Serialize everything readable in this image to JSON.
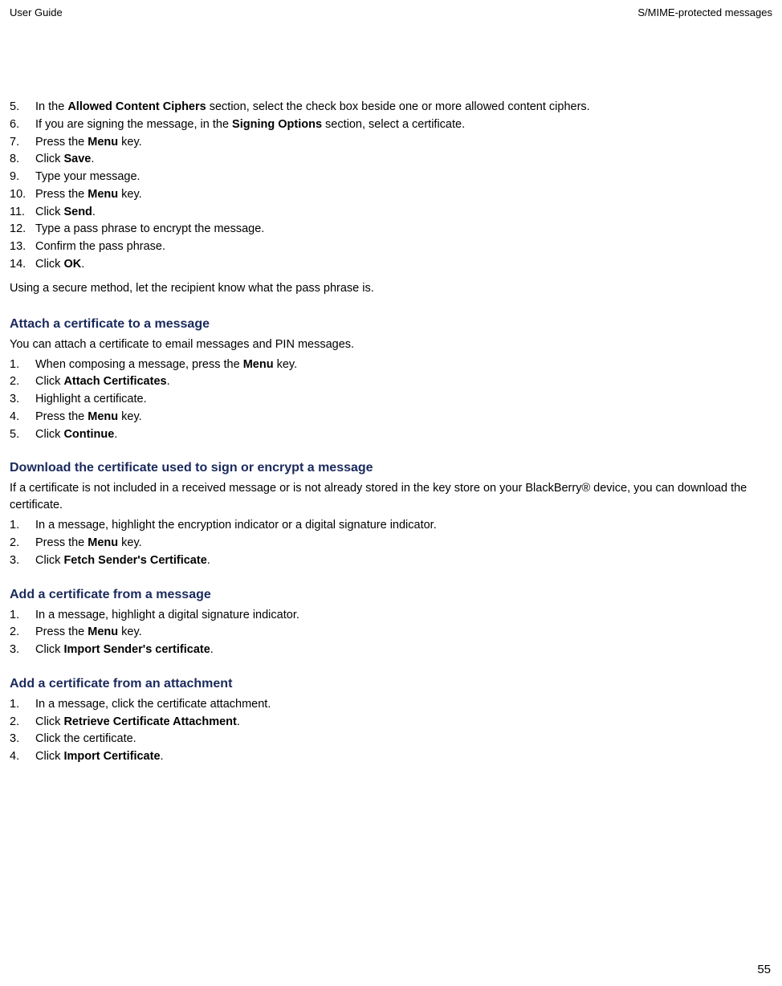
{
  "header": {
    "left": "User Guide",
    "right": "S/MIME-protected messages"
  },
  "firstList": {
    "items": [
      {
        "num": "5.",
        "pre": "In the ",
        "bold1": "Allowed Content Ciphers",
        "post": " section, select the check box beside one or more allowed content ciphers."
      },
      {
        "num": "6.",
        "pre": "If you are signing the message, in the ",
        "bold1": "Signing Options",
        "post": " section, select a certificate."
      },
      {
        "num": "7.",
        "pre": "Press the ",
        "bold1": "Menu",
        "post": " key."
      },
      {
        "num": "8.",
        "pre": "Click ",
        "bold1": "Save",
        "post": "."
      },
      {
        "num": "9.",
        "pre": "Type your message.",
        "bold1": "",
        "post": ""
      },
      {
        "num": "10.",
        "pre": "Press the ",
        "bold1": "Menu",
        "post": " key."
      },
      {
        "num": "11.",
        "pre": "Click ",
        "bold1": "Send",
        "post": "."
      },
      {
        "num": "12.",
        "pre": "Type a pass phrase to encrypt the message.",
        "bold1": "",
        "post": ""
      },
      {
        "num": "13.",
        "pre": "Confirm the pass phrase.",
        "bold1": "",
        "post": ""
      },
      {
        "num": "14.",
        "pre": "Click ",
        "bold1": "OK",
        "post": "."
      }
    ]
  },
  "note": "Using a secure method, let the recipient know what the pass phrase is.",
  "sections": [
    {
      "heading": "Attach a certificate to a message",
      "intro": "You can attach a certificate to email messages and PIN messages.",
      "steps": [
        {
          "num": "1.",
          "pre": "When composing a message, press the ",
          "bold1": "Menu",
          "post": " key."
        },
        {
          "num": "2.",
          "pre": "Click ",
          "bold1": "Attach Certificates",
          "post": "."
        },
        {
          "num": "3.",
          "pre": "Highlight a certificate.",
          "bold1": "",
          "post": ""
        },
        {
          "num": "4.",
          "pre": "Press the ",
          "bold1": "Menu",
          "post": " key."
        },
        {
          "num": "5.",
          "pre": "Click ",
          "bold1": "Continue",
          "post": "."
        }
      ]
    },
    {
      "heading": "Download the certificate used to sign or encrypt a message",
      "intro": "If a certificate is not included in a received message or is not already stored in the key store on your BlackBerry® device, you can download the certificate.",
      "steps": [
        {
          "num": "1.",
          "pre": "In a message, highlight the encryption indicator or a digital signature indicator.",
          "bold1": "",
          "post": ""
        },
        {
          "num": "2.",
          "pre": "Press the ",
          "bold1": "Menu",
          "post": " key."
        },
        {
          "num": "3.",
          "pre": "Click ",
          "bold1": "Fetch Sender's Certificate",
          "post": "."
        }
      ]
    },
    {
      "heading": "Add a certificate from a message",
      "intro": "",
      "steps": [
        {
          "num": "1.",
          "pre": "In a message, highlight a digital signature indicator.",
          "bold1": "",
          "post": ""
        },
        {
          "num": "2.",
          "pre": "Press the ",
          "bold1": "Menu",
          "post": " key."
        },
        {
          "num": "3.",
          "pre": "Click ",
          "bold1": "Import Sender's certificate",
          "post": "."
        }
      ]
    },
    {
      "heading": "Add a certificate from an attachment",
      "intro": "",
      "steps": [
        {
          "num": "1.",
          "pre": "In a message, click the certificate attachment.",
          "bold1": "",
          "post": ""
        },
        {
          "num": "2.",
          "pre": "Click ",
          "bold1": "Retrieve Certificate Attachment",
          "post": "."
        },
        {
          "num": "3.",
          "pre": "Click the certificate.",
          "bold1": "",
          "post": ""
        },
        {
          "num": "4.",
          "pre": "Click ",
          "bold1": "Import Certificate",
          "post": "."
        }
      ]
    }
  ],
  "pageNumber": "55"
}
